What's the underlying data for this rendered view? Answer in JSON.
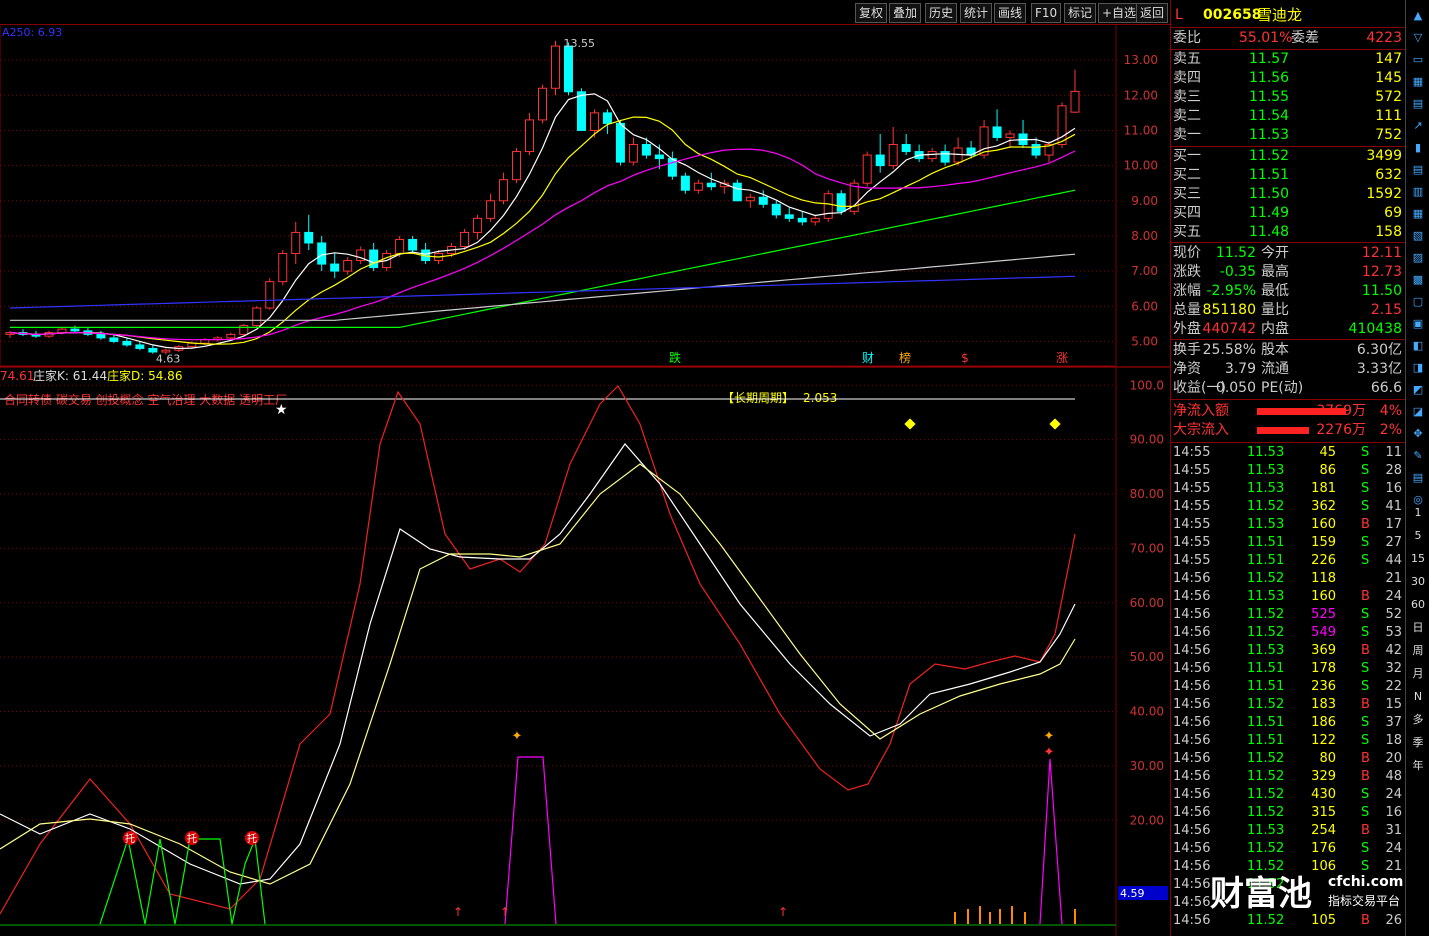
{
  "toolbar": {
    "buttons": [
      "复权",
      "叠加",
      "历史",
      "统计",
      "画线",
      "F10",
      "标记",
      "+自选",
      "返回"
    ]
  },
  "main_chart": {
    "ma_label": "A250: 6.93",
    "high_label": "13.55",
    "low_label": "4.63",
    "y_ticks": [
      "13.00",
      "12.00",
      "11.00",
      "10.00",
      "9.00",
      "8.00",
      "7.00",
      "6.00",
      "5.00"
    ],
    "event_tags": [
      "跌",
      "财",
      "榜",
      "$",
      "涨"
    ]
  },
  "indicator": {
    "header_value": "74.61",
    "k_label": "庄家K: 61.44",
    "d_label": "庄家D: 54.86",
    "concepts": "合同转债 碳交易 创投概念 空气治理 大数据 透明工厂",
    "cycle_label": "【长期周期】",
    "cycle_value": "2.053",
    "y_ticks": [
      "100.0",
      "90.00",
      "80.00",
      "70.00",
      "60.00",
      "50.00",
      "40.00",
      "30.00",
      "20.00"
    ],
    "bottom_value": "4.59",
    "tuo_label": "托"
  },
  "chart_data": {
    "type": "line",
    "title": "",
    "price_ylim": [
      4.5,
      13.8
    ],
    "indicator_ylim": [
      0,
      103
    ],
    "candles": [
      [
        5.2,
        5.3,
        5.1,
        5.25
      ],
      [
        5.25,
        5.35,
        5.15,
        5.2
      ],
      [
        5.2,
        5.3,
        5.1,
        5.15
      ],
      [
        5.15,
        5.3,
        5.1,
        5.25
      ],
      [
        5.25,
        5.4,
        5.2,
        5.35
      ],
      [
        5.35,
        5.45,
        5.25,
        5.3
      ],
      [
        5.3,
        5.4,
        5.15,
        5.2
      ],
      [
        5.2,
        5.3,
        5.05,
        5.1
      ],
      [
        5.1,
        5.2,
        4.95,
        5.0
      ],
      [
        5.0,
        5.1,
        4.85,
        4.9
      ],
      [
        4.9,
        5.0,
        4.75,
        4.8
      ],
      [
        4.8,
        4.9,
        4.65,
        4.7
      ],
      [
        4.7,
        4.8,
        4.63,
        4.75
      ],
      [
        4.75,
        4.9,
        4.7,
        4.85
      ],
      [
        4.85,
        5.0,
        4.8,
        4.95
      ],
      [
        4.95,
        5.1,
        4.9,
        5.05
      ],
      [
        5.05,
        5.15,
        5.0,
        5.1
      ],
      [
        5.1,
        5.25,
        5.05,
        5.2
      ],
      [
        5.2,
        5.5,
        5.15,
        5.45
      ],
      [
        5.45,
        6.0,
        5.4,
        5.95
      ],
      [
        5.95,
        6.8,
        5.9,
        6.7
      ],
      [
        6.7,
        7.6,
        6.6,
        7.5
      ],
      [
        7.5,
        8.4,
        7.2,
        8.1
      ],
      [
        8.1,
        8.6,
        7.6,
        7.8
      ],
      [
        7.8,
        8.0,
        7.0,
        7.2
      ],
      [
        7.2,
        7.5,
        6.8,
        7.0
      ],
      [
        7.0,
        7.4,
        6.9,
        7.3
      ],
      [
        7.3,
        7.7,
        7.2,
        7.6
      ],
      [
        7.6,
        7.8,
        7.0,
        7.1
      ],
      [
        7.1,
        7.6,
        7.0,
        7.5
      ],
      [
        7.5,
        8.0,
        7.4,
        7.9
      ],
      [
        7.9,
        8.0,
        7.5,
        7.6
      ],
      [
        7.6,
        7.8,
        7.2,
        7.3
      ],
      [
        7.3,
        7.6,
        7.2,
        7.5
      ],
      [
        7.5,
        7.8,
        7.4,
        7.7
      ],
      [
        7.7,
        8.2,
        7.6,
        8.1
      ],
      [
        8.1,
        8.6,
        7.9,
        8.5
      ],
      [
        8.5,
        9.2,
        8.4,
        9.0
      ],
      [
        9.0,
        9.8,
        8.9,
        9.6
      ],
      [
        9.6,
        10.5,
        9.5,
        10.4
      ],
      [
        10.4,
        11.5,
        10.3,
        11.3
      ],
      [
        11.3,
        12.3,
        11.2,
        12.2
      ],
      [
        12.2,
        13.55,
        12.0,
        13.4
      ],
      [
        13.4,
        13.5,
        12.0,
        12.1
      ],
      [
        12.1,
        12.2,
        11.0,
        11.0
      ],
      [
        11.0,
        11.6,
        10.8,
        11.5
      ],
      [
        11.5,
        11.6,
        10.9,
        11.2
      ],
      [
        11.2,
        11.3,
        10.0,
        10.1
      ],
      [
        10.1,
        10.8,
        10.0,
        10.6
      ],
      [
        10.6,
        10.8,
        10.2,
        10.3
      ],
      [
        10.3,
        10.6,
        9.9,
        10.2
      ],
      [
        10.2,
        10.4,
        9.6,
        9.7
      ],
      [
        9.7,
        9.8,
        9.2,
        9.3
      ],
      [
        9.3,
        9.6,
        9.2,
        9.5
      ],
      [
        9.5,
        9.8,
        9.3,
        9.4
      ],
      [
        9.4,
        9.6,
        9.2,
        9.5
      ],
      [
        9.5,
        9.6,
        9.0,
        9.0
      ],
      [
        9.0,
        9.2,
        8.8,
        9.1
      ],
      [
        9.1,
        9.3,
        8.8,
        8.9
      ],
      [
        8.9,
        9.0,
        8.5,
        8.6
      ],
      [
        8.6,
        8.8,
        8.4,
        8.5
      ],
      [
        8.5,
        8.7,
        8.3,
        8.4
      ],
      [
        8.4,
        8.6,
        8.3,
        8.5
      ],
      [
        8.5,
        9.3,
        8.4,
        9.2
      ],
      [
        9.2,
        9.3,
        8.6,
        8.7
      ],
      [
        8.7,
        9.6,
        8.6,
        9.5
      ],
      [
        9.5,
        10.4,
        9.4,
        10.3
      ],
      [
        10.3,
        10.9,
        9.8,
        10.0
      ],
      [
        10.0,
        11.1,
        9.9,
        10.6
      ],
      [
        10.6,
        10.9,
        10.3,
        10.4
      ],
      [
        10.4,
        10.6,
        10.1,
        10.2
      ],
      [
        10.2,
        10.5,
        10.1,
        10.4
      ],
      [
        10.4,
        10.6,
        10.0,
        10.1
      ],
      [
        10.1,
        10.8,
        10.0,
        10.5
      ],
      [
        10.5,
        10.7,
        10.2,
        10.3
      ],
      [
        10.3,
        11.3,
        10.2,
        11.1
      ],
      [
        11.1,
        11.6,
        10.7,
        10.8
      ],
      [
        10.8,
        11.0,
        10.5,
        10.9
      ],
      [
        10.9,
        11.3,
        10.5,
        10.6
      ],
      [
        10.6,
        10.8,
        10.2,
        10.3
      ],
      [
        10.3,
        10.7,
        10.1,
        10.6
      ],
      [
        10.6,
        11.8,
        10.5,
        11.7
      ],
      [
        11.52,
        12.73,
        11.5,
        12.11
      ]
    ],
    "series": [],
    "indicator_series": []
  },
  "quote": {
    "code": "002658",
    "name": "雪迪龙",
    "corner": "L",
    "weibi_label": "委比",
    "weibi": "55.01%",
    "weicha_label": "委差",
    "weicha": "4223",
    "asks": [
      {
        "label": "卖五",
        "price": "11.57",
        "vol": "147"
      },
      {
        "label": "卖四",
        "price": "11.56",
        "vol": "145"
      },
      {
        "label": "卖三",
        "price": "11.55",
        "vol": "572"
      },
      {
        "label": "卖二",
        "price": "11.54",
        "vol": "111"
      },
      {
        "label": "卖一",
        "price": "11.53",
        "vol": "752"
      }
    ],
    "bids": [
      {
        "label": "买一",
        "price": "11.52",
        "vol": "3499"
      },
      {
        "label": "买二",
        "price": "11.51",
        "vol": "632"
      },
      {
        "label": "买三",
        "price": "11.50",
        "vol": "1592"
      },
      {
        "label": "买四",
        "price": "11.49",
        "vol": "69"
      },
      {
        "label": "买五",
        "price": "11.48",
        "vol": "158"
      }
    ],
    "stats": [
      {
        "l1": "现价",
        "v1": "11.52",
        "l2": "今开",
        "v2": "12.11",
        "c1": "#0f0",
        "c2": "#f33"
      },
      {
        "l1": "涨跌",
        "v1": "-0.35",
        "l2": "最高",
        "v2": "12.73",
        "c1": "#0f0",
        "c2": "#f33"
      },
      {
        "l1": "涨幅",
        "v1": "-2.95%",
        "l2": "最低",
        "v2": "11.50",
        "c1": "#0f0",
        "c2": "#0f0"
      },
      {
        "l1": "总量",
        "v1": "851180",
        "l2": "量比",
        "v2": "2.15",
        "c1": "#ff0",
        "c2": "#f33"
      },
      {
        "l1": "外盘",
        "v1": "440742",
        "l2": "内盘",
        "v2": "410438",
        "c1": "#f33",
        "c2": "#0f0"
      }
    ],
    "stats2": [
      {
        "l1": "换手",
        "v1": "25.58%",
        "l2": "股本",
        "v2": "6.30亿"
      },
      {
        "l1": "净资",
        "v1": "3.79",
        "l2": "流通",
        "v2": "3.33亿"
      },
      {
        "l1": "收益(一)",
        "v1": "0.050",
        "l2": "PE(动)",
        "v2": "66.6"
      }
    ],
    "flow": [
      {
        "label": "净流入额",
        "value": "3769万",
        "pct": "4%"
      },
      {
        "label": "大宗流入",
        "value": "2276万",
        "pct": "2%"
      }
    ],
    "ticks": [
      [
        "14:55",
        "11.53",
        "45",
        "S",
        "11"
      ],
      [
        "14:55",
        "11.53",
        "86",
        "S",
        "28"
      ],
      [
        "14:55",
        "11.53",
        "181",
        "S",
        "16"
      ],
      [
        "14:55",
        "11.52",
        "362",
        "S",
        "41"
      ],
      [
        "14:55",
        "11.53",
        "160",
        "B",
        "17"
      ],
      [
        "14:55",
        "11.51",
        "159",
        "S",
        "27"
      ],
      [
        "14:55",
        "11.51",
        "226",
        "S",
        "44"
      ],
      [
        "14:56",
        "11.52",
        "118",
        "",
        "21"
      ],
      [
        "14:56",
        "11.53",
        "160",
        "B",
        "24"
      ],
      [
        "14:56",
        "11.52",
        "525",
        "S",
        "52"
      ],
      [
        "14:56",
        "11.52",
        "549",
        "S",
        "53"
      ],
      [
        "14:56",
        "11.53",
        "369",
        "B",
        "42"
      ],
      [
        "14:56",
        "11.51",
        "178",
        "S",
        "32"
      ],
      [
        "14:56",
        "11.51",
        "236",
        "S",
        "22"
      ],
      [
        "14:56",
        "11.52",
        "183",
        "B",
        "15"
      ],
      [
        "14:56",
        "11.51",
        "186",
        "S",
        "37"
      ],
      [
        "14:56",
        "11.51",
        "122",
        "S",
        "18"
      ],
      [
        "14:56",
        "11.52",
        "80",
        "B",
        "20"
      ],
      [
        "14:56",
        "11.52",
        "329",
        "B",
        "48"
      ],
      [
        "14:56",
        "11.52",
        "430",
        "S",
        "24"
      ],
      [
        "14:56",
        "11.52",
        "315",
        "S",
        "16"
      ],
      [
        "14:56",
        "11.53",
        "254",
        "B",
        "31"
      ],
      [
        "14:56",
        "11.52",
        "176",
        "S",
        "24"
      ],
      [
        "14:56",
        "11.52",
        "106",
        "S",
        "21"
      ],
      [
        "14:56",
        "11.52",
        "",
        "",
        ""
      ],
      [
        "14:56",
        "",
        "",
        "",
        ""
      ],
      [
        "14:56",
        "11.52",
        "105",
        "B",
        "26"
      ]
    ]
  },
  "side_tools": [
    "1",
    "5",
    "15",
    "30",
    "60",
    "日",
    "周",
    "月",
    "N",
    "多",
    "季",
    "年"
  ],
  "watermark": {
    "main": "财富池",
    "site": "cfchi.com",
    "sub": "指标交易平台"
  },
  "colors": {
    "up": "#f33",
    "down": "#0ff",
    "grid": "#800000",
    "ma5": "#fff",
    "ma10": "#ff0",
    "ma20": "#f0f",
    "ma60": "#0f0",
    "ma120": "#ccc",
    "ma250": "#33f"
  }
}
